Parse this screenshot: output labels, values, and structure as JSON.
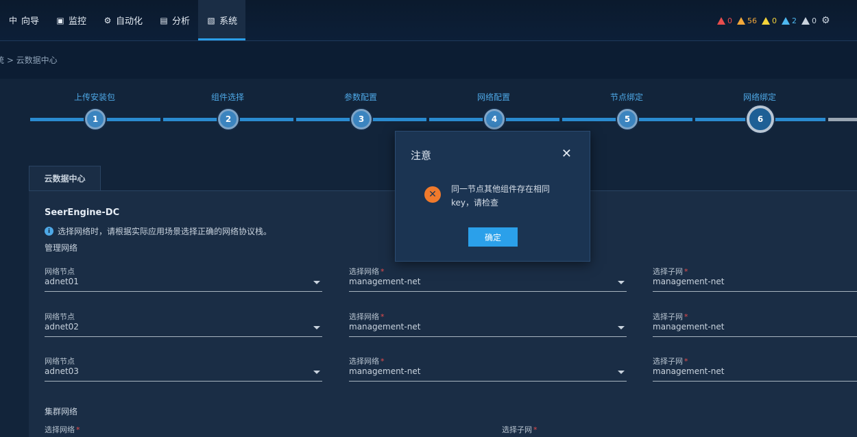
{
  "nav": {
    "items": [
      {
        "icon": "compass-icon",
        "glyph": "中",
        "label": "向导",
        "active": false
      },
      {
        "icon": "monitor-icon",
        "glyph": "▣",
        "label": "监控",
        "active": false
      },
      {
        "icon": "automation-icon",
        "glyph": "⚙",
        "label": "自动化",
        "active": false
      },
      {
        "icon": "chart-icon",
        "glyph": "▤",
        "label": "分析",
        "active": false
      },
      {
        "icon": "system-icon",
        "glyph": "▧",
        "label": "系统",
        "active": true
      }
    ]
  },
  "alarms": [
    {
      "color": "#e84d4d",
      "count": "0"
    },
    {
      "color": "#f2a83a",
      "count": "56"
    },
    {
      "color": "#f5d43a",
      "count": "0"
    },
    {
      "color": "#4eb8f0",
      "count": "2"
    },
    {
      "color": "#c9d3de",
      "count": "0"
    }
  ],
  "breadcrumb": "统 > 云数据中心",
  "steps": [
    {
      "label": "上传安装包",
      "num": "1"
    },
    {
      "label": "组件选择",
      "num": "2"
    },
    {
      "label": "参数配置",
      "num": "3"
    },
    {
      "label": "网络配置",
      "num": "4"
    },
    {
      "label": "节点绑定",
      "num": "5"
    },
    {
      "label": "网络绑定",
      "num": "6"
    }
  ],
  "panel": {
    "tab": "云数据中心",
    "product": "SeerEngine-DC",
    "info": "选择网络时，请根据实际应用场景选择正确的网络协议栈。",
    "mgmt_title": "管理网络",
    "cluster_title": "集群网络",
    "rows": [
      {
        "node_label": "网络节点",
        "node": "adnet01",
        "net_label": "选择网络",
        "net": "management-net",
        "subnet_label": "选择子网",
        "subnet": "management-net"
      },
      {
        "node_label": "网络节点",
        "node": "adnet02",
        "net_label": "选择网络",
        "net": "management-net",
        "subnet_label": "选择子网",
        "subnet": "management-net"
      },
      {
        "node_label": "网络节点",
        "node": "adnet03",
        "net_label": "选择网络",
        "net": "management-net",
        "subnet_label": "选择子网",
        "subnet": "management-net"
      }
    ],
    "cluster": {
      "net_label": "选择网络",
      "subnet_label": "选择子网"
    }
  },
  "modal": {
    "title": "注意",
    "message": "同一节点其他组件存在相同key，请检查",
    "ok": "确定"
  }
}
